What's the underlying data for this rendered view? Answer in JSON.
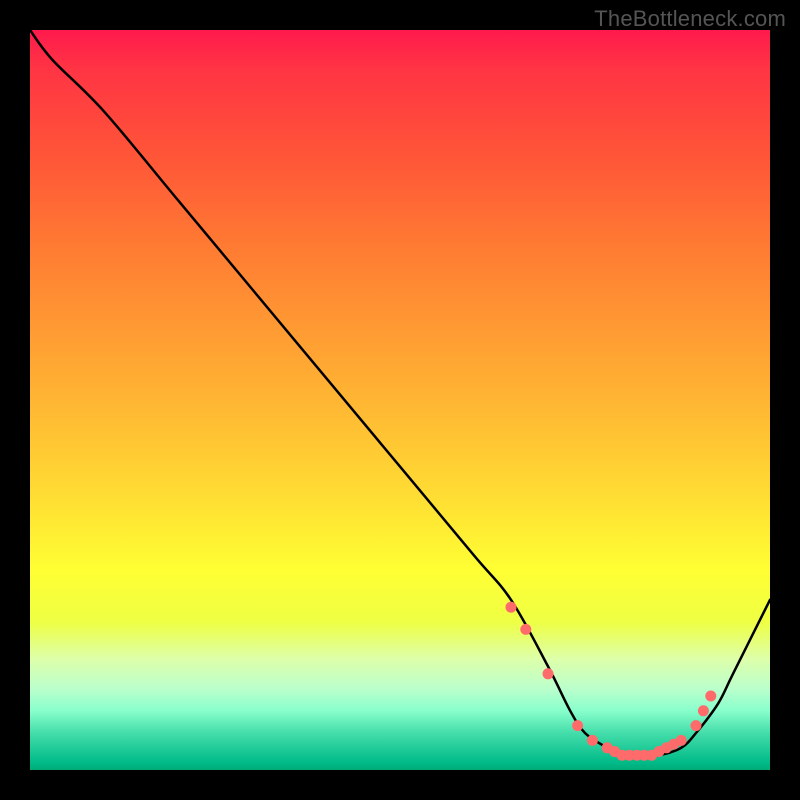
{
  "watermark": "TheBottleneck.com",
  "chart_data": {
    "type": "line",
    "title": "",
    "xlabel": "",
    "ylabel": "",
    "xlim": [
      0,
      100
    ],
    "ylim": [
      0,
      100
    ],
    "series": [
      {
        "name": "curve",
        "x": [
          0,
          3,
          10,
          20,
          30,
          40,
          50,
          60,
          65,
          70,
          73,
          75,
          78,
          80,
          83,
          85,
          88,
          90,
          93,
          95,
          100
        ],
        "y": [
          100,
          96,
          89,
          77,
          65,
          53,
          41,
          29,
          23,
          14,
          8,
          5,
          3,
          2,
          2,
          2,
          3,
          5,
          9,
          13,
          23
        ]
      }
    ],
    "markers": {
      "name": "dots",
      "color": "#ff6b6b",
      "x": [
        65,
        67,
        70,
        74,
        76,
        78,
        79,
        80,
        81,
        82,
        83,
        84,
        85,
        86,
        87,
        88,
        90,
        91,
        92
      ],
      "y": [
        22,
        19,
        13,
        6,
        4,
        3,
        2.5,
        2,
        2,
        2,
        2,
        2,
        2.5,
        3,
        3.5,
        4,
        6,
        8,
        10
      ]
    }
  }
}
